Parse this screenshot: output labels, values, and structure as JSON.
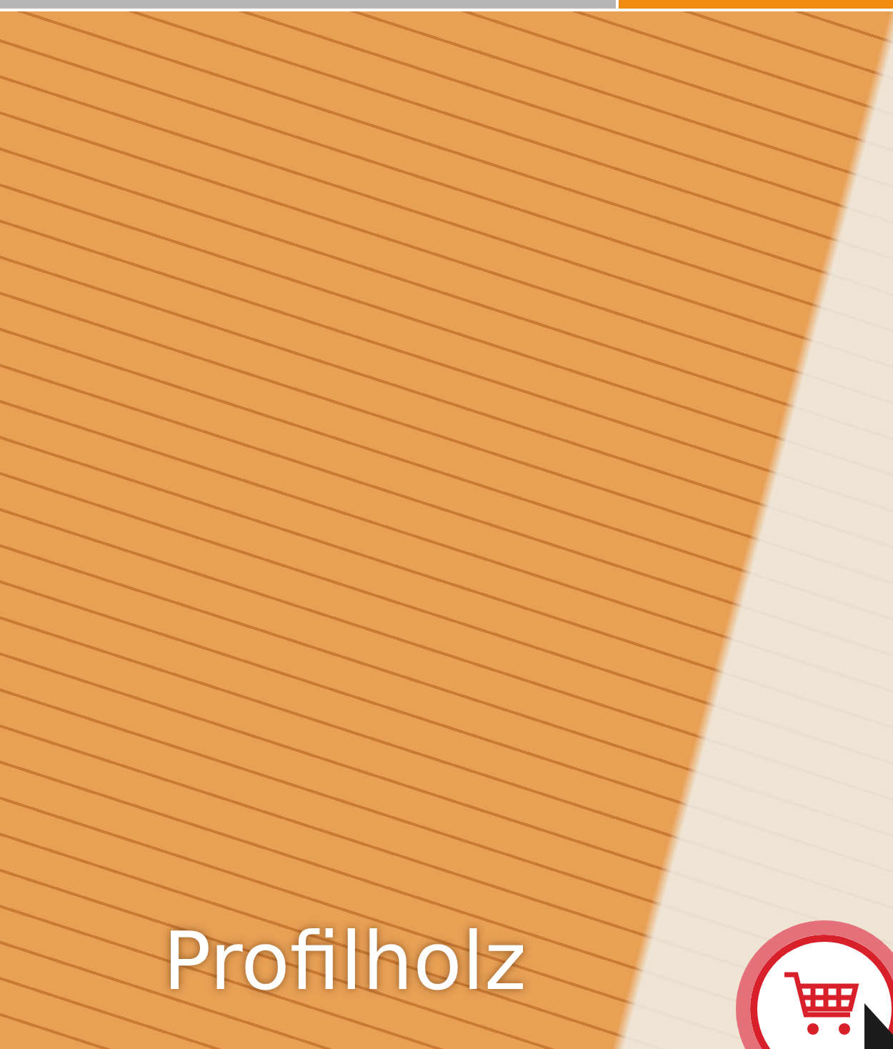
{
  "indicators": [
    {
      "selected": false
    },
    {
      "selected": true
    }
  ],
  "tile": {
    "caption": "Profilholz"
  }
}
